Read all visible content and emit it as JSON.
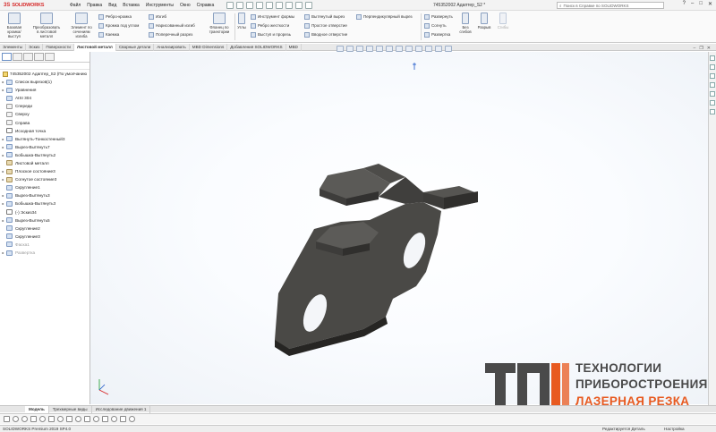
{
  "app": {
    "logo_text": "SOLIDWORKS",
    "document_title": "745352002 Адаптер_S2 *",
    "menus": [
      "Файл",
      "Правка",
      "Вид",
      "Вставка",
      "Инструменты",
      "Окно",
      "Справка"
    ],
    "search_placeholder": "Поиск в Справке по SOLIDWORKS"
  },
  "commands": {
    "big": [
      {
        "label": "Базовая кромка/выступ"
      },
      {
        "label": "Преобразовать в листовой металл"
      },
      {
        "label": "Элемент по сечениям изгиба"
      }
    ],
    "col1": [
      "Ребро-кромка",
      "Кромка под углом",
      "Каемка"
    ],
    "col2": [
      "Изгиб",
      "Нарисованный изгиб",
      "Поперечный разрез"
    ],
    "fold": {
      "label": "Фланец по траектории"
    },
    "corners": {
      "label": "Углы"
    },
    "col3": [
      "Инструмент формы",
      "Ребро жесткости",
      "Выступ и прорезь"
    ],
    "col4": [
      "Вытянутый вырез",
      "Простое отверстие",
      "Вводное отверстие"
    ],
    "col5": [
      "Перпендикулярный вырез"
    ],
    "col6": [
      "Развернуть",
      "Согнуть",
      "Развертка"
    ],
    "nobend": {
      "label": "Без сгибов"
    },
    "rip": {
      "label": "Разрыв"
    },
    "solid": {
      "label": "Сгибы"
    }
  },
  "tabs": [
    "Элементы",
    "Эскиз",
    "Поверхности",
    "Листовой металл",
    "Сварные детали",
    "Анализировать",
    "MBD Dimensions",
    "Добавления SOLIDWORKS",
    "MBD"
  ],
  "active_tab": "Листовой металл",
  "tree": {
    "root": "745352002 Адаптер_S2  (По умолчанию",
    "items": [
      {
        "label": "Список вырезов(1)",
        "icon": "folder",
        "arrow": true,
        "suppressed": false
      },
      {
        "label": "Уравнения",
        "icon": "folder",
        "arrow": true,
        "suppressed": false
      },
      {
        "label": "AISI 304",
        "icon": "folder",
        "arrow": false,
        "suppressed": false
      },
      {
        "label": "Спереди",
        "icon": "plane",
        "arrow": false,
        "suppressed": false
      },
      {
        "label": "Сверху",
        "icon": "plane",
        "arrow": false,
        "suppressed": false
      },
      {
        "label": "Справа",
        "icon": "plane",
        "arrow": false,
        "suppressed": false
      },
      {
        "label": "Исходная точка",
        "icon": "sketch",
        "arrow": false,
        "suppressed": false
      },
      {
        "label": "Вытянуть-Тонкостенный3",
        "icon": "feature",
        "arrow": true,
        "suppressed": false
      },
      {
        "label": "Вырез-Вытянуть7",
        "icon": "feature",
        "arrow": true,
        "suppressed": false
      },
      {
        "label": "Бобышка-Вытянуть2",
        "icon": "feature",
        "arrow": true,
        "suppressed": false
      },
      {
        "label": "Листовой металл",
        "icon": "sheetmetal",
        "arrow": false,
        "suppressed": false
      },
      {
        "label": "Плоское состояние3",
        "icon": "sheetmetal",
        "arrow": true,
        "suppressed": false
      },
      {
        "label": "Согнутое состояние3",
        "icon": "sheetmetal",
        "arrow": true,
        "suppressed": false
      },
      {
        "label": "Скругление1",
        "icon": "feature",
        "arrow": false,
        "suppressed": false
      },
      {
        "label": "Вырез-Вытянуть3",
        "icon": "feature",
        "arrow": true,
        "suppressed": false
      },
      {
        "label": "Бобышка-Вытянуть3",
        "icon": "feature",
        "arrow": true,
        "suppressed": false
      },
      {
        "label": "(-) Эскиз34",
        "icon": "sketch",
        "arrow": false,
        "suppressed": false
      },
      {
        "label": "Вырез-Вытянуть5",
        "icon": "feature",
        "arrow": true,
        "suppressed": false
      },
      {
        "label": "Скругление2",
        "icon": "feature",
        "arrow": false,
        "suppressed": false
      },
      {
        "label": "Скругление3",
        "icon": "feature",
        "arrow": false,
        "suppressed": false
      },
      {
        "label": "Фаска1",
        "icon": "feature",
        "arrow": false,
        "suppressed": true
      },
      {
        "label": "Развертка",
        "icon": "feature",
        "arrow": true,
        "suppressed": true
      }
    ]
  },
  "brand": {
    "line1": "ТЕХНОЛОГИИ",
    "line2": "ПРИБОРОСТРОЕНИЯ",
    "line3": "ЛАЗЕРНАЯ РЕЗКА",
    "colors": {
      "gray": "#4a4a4a",
      "orange": "#e85a20"
    }
  },
  "bottom_tabs": [
    "Модель",
    "Трехмерные виды",
    "Исследование движения 1"
  ],
  "active_bottom_tab": "Модель",
  "status": {
    "left": "SOLIDWORKS Premium 2019 SP4.0",
    "mid": "Редактируется Деталь",
    "right": "Настройка"
  },
  "colors": {
    "part": "#4b4a47",
    "accent": "#d62b2b"
  }
}
